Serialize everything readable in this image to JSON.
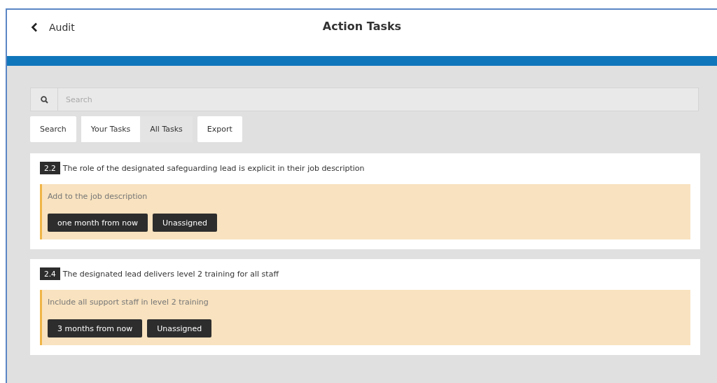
{
  "header": {
    "back_label": "Audit",
    "title": "Action Tasks"
  },
  "search": {
    "placeholder": "Search"
  },
  "toolbar": {
    "search_button": "Search",
    "filters": [
      {
        "label": "Your Tasks",
        "selected": false
      },
      {
        "label": "All Tasks",
        "selected": true
      }
    ],
    "export_button": "Export"
  },
  "tasks": [
    {
      "number": "2.2",
      "title": "The role of the designated safeguarding lead is explicit in their job description",
      "action": "Add to the job description",
      "due": "one month from now",
      "assignee": "Unassigned"
    },
    {
      "number": "2.4",
      "title": "The designated lead delivers level 2 training for all staff",
      "action": "Include all support staff in level 2 training",
      "due": "3 months from now",
      "assignee": "Unassigned"
    }
  ]
}
